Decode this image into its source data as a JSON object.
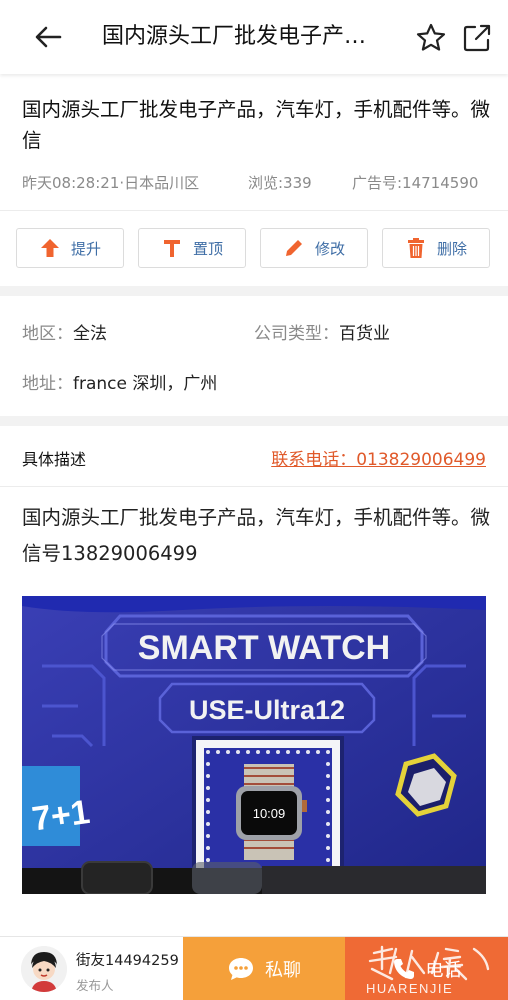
{
  "header": {
    "title": "国内源头工厂批发电子产品，汽车灯，手机配件等。微信",
    "back_icon": "back-arrow-icon",
    "favorite_icon": "star-icon",
    "share_icon": "share-icon"
  },
  "post": {
    "title": "国内源头工厂批发电子产品，汽车灯，手机配件等。微信",
    "time_location": "昨天08:28:21·日本品川区",
    "views": "浏览:339",
    "ad_number": "广告号:14714590"
  },
  "actions": [
    {
      "label": "提升",
      "icon": "arrow-up-icon"
    },
    {
      "label": "置顶",
      "icon": "pin-top-icon"
    },
    {
      "label": "修改",
      "icon": "pencil-icon"
    },
    {
      "label": "删除",
      "icon": "trash-icon"
    }
  ],
  "info": {
    "region_label": "地区：",
    "region_value": "全法",
    "company_type_label": "公司类型：",
    "company_type_value": "百货业",
    "address_label": "地址：",
    "address_value": "france 深圳，广州"
  },
  "description": {
    "heading": "具体描述",
    "phone": "联系电话：013829006499",
    "body": "国内源头工厂批发电子产品，汽车灯，手机配件等。微信号13829006499"
  },
  "photo": {
    "box_title": "SMART WATCH",
    "model": "USE-Ultra12",
    "side_text": "7+1",
    "watch_time": "10:09"
  },
  "bottom": {
    "user_name": "街友14494259",
    "user_role": "发布人",
    "pm_label": "私聊",
    "call_label": "电话",
    "watermark": "HUARENJIE"
  },
  "colors": {
    "accent_orange": "#ef6a35",
    "pm_orange": "#f5a03a",
    "action_blue": "#3f6ea6",
    "icon_orange": "#f0642f",
    "phone_link": "#e05a2b"
  }
}
